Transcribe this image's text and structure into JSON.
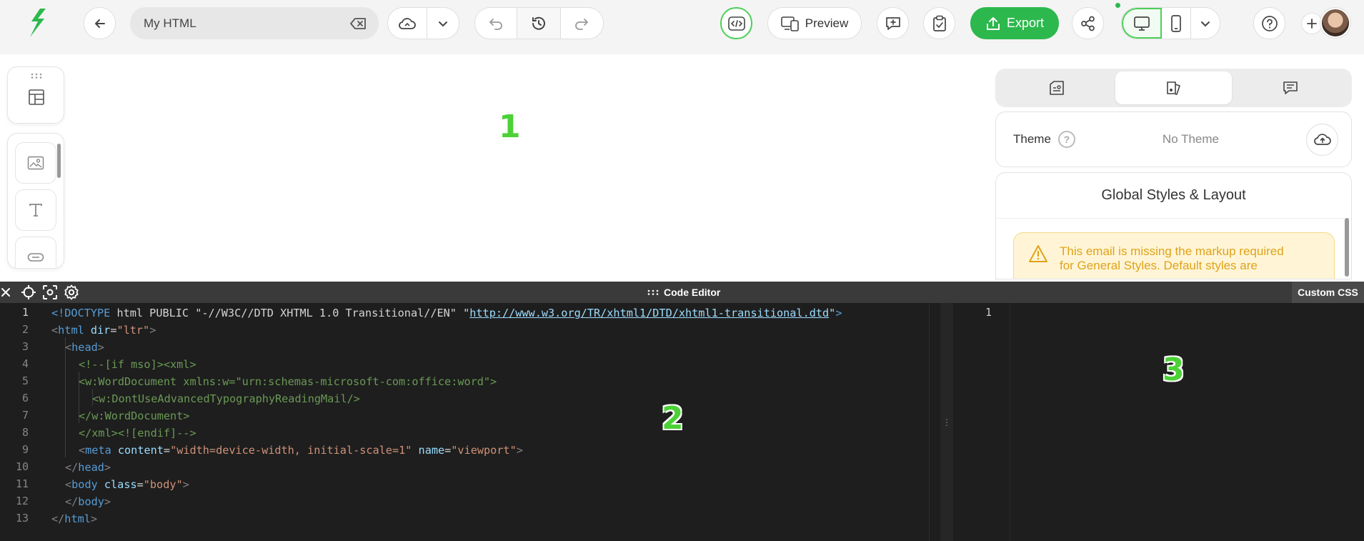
{
  "toolbar": {
    "logo_icon": "stripo-logo-icon",
    "back_icon": "arrow-left-icon",
    "email_name": "My HTML",
    "clear_icon": "backspace-icon",
    "save_icon": "cloud-sync-icon",
    "save_menu_icon": "chevron-down-icon",
    "undo_icon": "undo-icon",
    "history_icon": "history-icon",
    "redo_icon": "redo-icon",
    "code_icon": "code-icon",
    "preview_label": "Preview",
    "preview_icon": "devices-icon",
    "add_comment_icon": "comment-plus-icon",
    "test_icon": "clipboard-check-icon",
    "export_label": "Export",
    "export_icon": "upload-icon",
    "share_icon": "share-icon",
    "desktop_icon": "desktop-icon",
    "mobile_icon": "mobile-icon",
    "device_menu_icon": "chevron-down-icon",
    "help_icon": "help-icon",
    "add_collaborator_icon": "plus-icon",
    "avatar": "user-avatar"
  },
  "canvas": {
    "left_tools": [
      "structures-icon",
      "image-icon",
      "text-icon",
      "button-icon"
    ],
    "right_panel": {
      "tabs": [
        "settings-icon",
        "appearance-icon",
        "comments-icon"
      ],
      "active_tab": 1,
      "theme_label": "Theme",
      "theme_help": "?",
      "theme_value": "No Theme",
      "theme_upload_icon": "cloud-upload-icon",
      "global_styles_title": "Global Styles & Layout",
      "warning_line1": "This email is missing the markup required",
      "warning_line2": "for General Styles. Default styles are"
    }
  },
  "annotations": [
    "1",
    "2",
    "3"
  ],
  "editor": {
    "title": "Code Editor",
    "close_icon": "close-icon",
    "locate_icon": "crosshair-icon",
    "focus_icon": "focus-icon",
    "settings_icon": "gear-icon",
    "custom_css_label": "Custom CSS",
    "html_lines": [
      "<!DOCTYPE html PUBLIC \"-//W3C//DTD XHTML 1.0 Transitional//EN\" \"http://www.w3.org/TR/xhtml1/DTD/xhtml1-transitional.dtd\">",
      "<html dir=\"ltr\">",
      "<head>",
      "<!--[if mso]><xml>",
      "<w:WordDocument xmlns:w=\"urn:schemas-microsoft-com:office:word\">",
      "<w:DontUseAdvancedTypographyReadingMail/>",
      "</w:WordDocument>",
      "</xml><![endif]-->",
      "<meta content=\"width=device-width, initial-scale=1\" name=\"viewport\">",
      "</head>",
      "<body class=\"body\">",
      "</body>",
      "</html>"
    ],
    "line_numbers": [
      "1",
      "2",
      "3",
      "4",
      "5",
      "6",
      "7",
      "8",
      "9",
      "10",
      "11",
      "12",
      "13"
    ],
    "css_line_numbers": [
      "1"
    ]
  }
}
